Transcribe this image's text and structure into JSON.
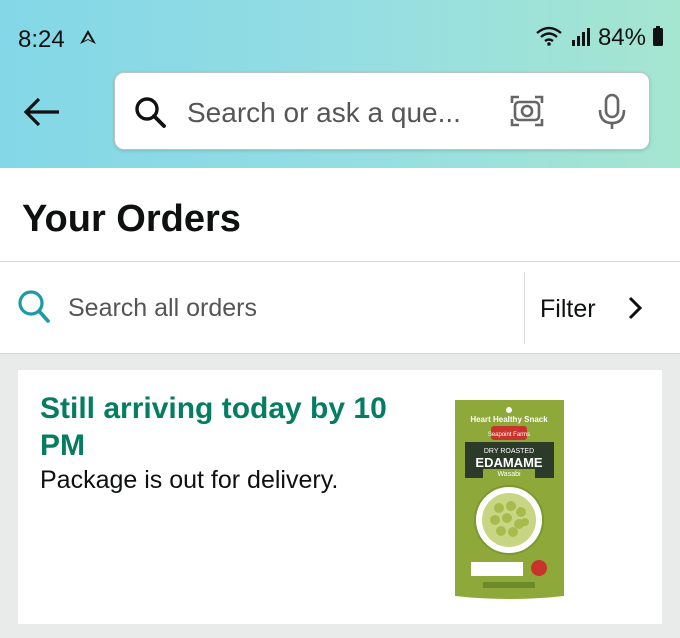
{
  "status_bar": {
    "time": "8:24",
    "battery": "84%"
  },
  "search": {
    "placeholder": "Search or ask a que..."
  },
  "page": {
    "title": "Your Orders"
  },
  "orders_search": {
    "placeholder": "Search all orders",
    "filter_label": "Filter"
  },
  "order": {
    "status": "Still arriving today by 10 PM",
    "substatus": "Package is out for delivery.",
    "product_label": {
      "tagline": "Heart Healthy Snack",
      "brand": "Seapoint Farms",
      "line1": "DRY ROASTED",
      "line2": "EDAMAME",
      "flavor": "Wasabi"
    }
  },
  "colors": {
    "accent_green": "#067d62",
    "search_icon_teal": "#1b9aa8"
  }
}
